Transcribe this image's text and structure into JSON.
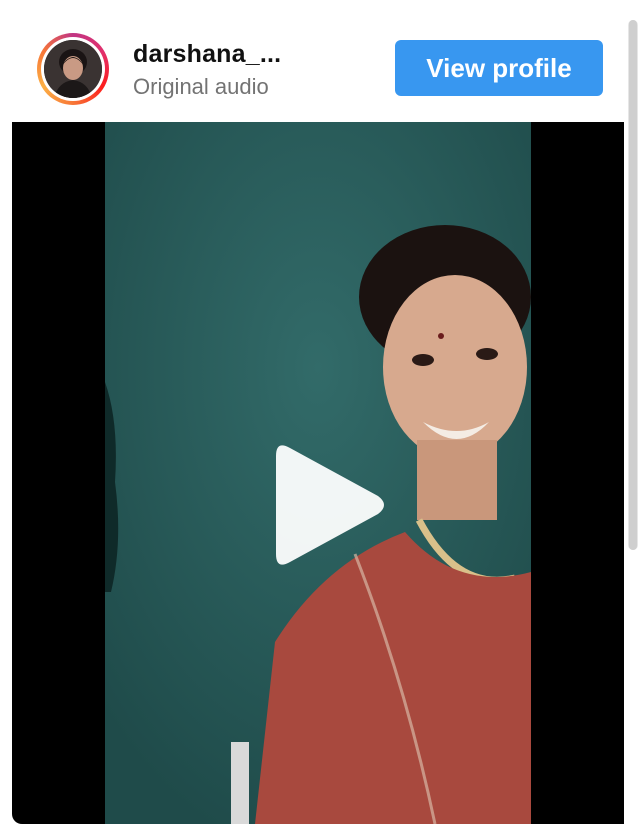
{
  "post": {
    "username": "darshana_...",
    "audio_label": "Original audio",
    "view_profile_label": "View profile"
  },
  "colors": {
    "button_bg": "#3897f0",
    "username": "#111111",
    "subtitle": "#737373",
    "video_bg": "#000000",
    "frame_bg": "#2e6463"
  },
  "icons": {
    "play": "play-icon",
    "avatar": "avatar"
  }
}
